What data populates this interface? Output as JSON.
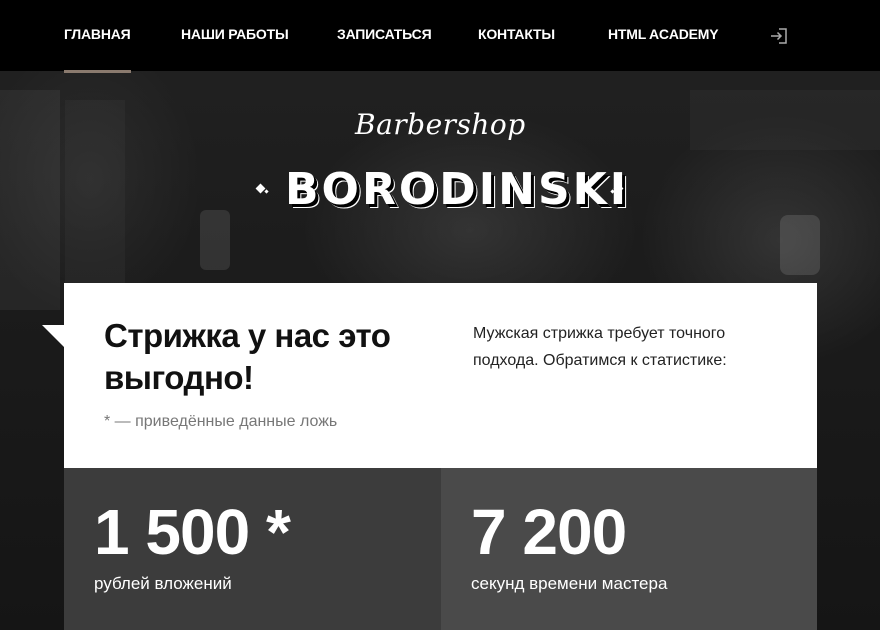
{
  "nav": {
    "items": [
      {
        "label": "ГЛАВНАЯ",
        "active": true
      },
      {
        "label": "НАШИ РАБОТЫ"
      },
      {
        "label": "ЗАПИСАТЬСЯ"
      },
      {
        "label": "КОНТАКТЫ"
      },
      {
        "label": "HTML ACADEMY"
      }
    ],
    "login_icon": "login-icon",
    "active_color": "#8a7a6e"
  },
  "logo": {
    "script": "Barbershop",
    "main": "BORODINSKI"
  },
  "intro": {
    "title": "Стрижка у нас это выгодно!",
    "note": "* — приведённые данные ложь",
    "text": "Мужская стрижка требует точного подхода. Обратимся к статистике:"
  },
  "stats": [
    {
      "value": "1 500 *",
      "label": "рублей вложений"
    },
    {
      "value": "7 200",
      "label": "секунд времени мастера"
    }
  ]
}
